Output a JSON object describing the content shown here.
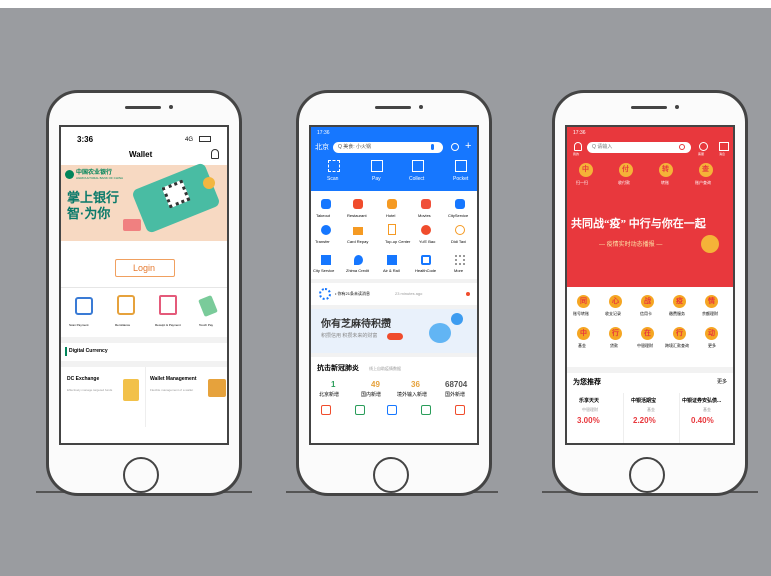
{
  "phone1": {
    "time": "3:36",
    "signal": "4G",
    "title": "Wallet",
    "bank_name": "中国农业银行",
    "bank_sub": "AGRICULTURAL BANK OF CHINA",
    "banner_line1": "掌上银行",
    "banner_line2": "智·为你",
    "login": "Login",
    "actions": [
      "Scan Payment",
      "Remittance",
      "Receipt & Payment",
      "Touch Pay"
    ],
    "section": "Digital Currency",
    "cards": [
      {
        "title": "DC Exchange",
        "desc": "Effectively manage targeted funds"
      },
      {
        "title": "Wallet Management",
        "desc": "Flexible management of a wallet"
      }
    ]
  },
  "phone2": {
    "time": "17:36",
    "city": "北京",
    "search": "Q 美食: 小火锅",
    "top_actions": [
      "Scan",
      "Pay",
      "Collect",
      "Pocket"
    ],
    "grid": [
      "Takeout",
      "Restaurant",
      "Hotel",
      "Movies",
      "CityService",
      "Transfer",
      "Card Repay",
      "Top-up Center",
      "Yu'E Bao",
      "Didi Taxi",
      "City Service",
      "Zhima Credit",
      "Air & Rail",
      "HealthCode",
      "More"
    ],
    "notice": "• 你有21条未读消息",
    "notice_time": "23 minutes ago",
    "promo_title": "你有芝麻待积攒",
    "promo_sub": "积攒信用 积攒未来的财富",
    "news_title": "抗击新冠肺炎",
    "news_sub": "线上自助疫情数据",
    "stats": [
      {
        "num": "1",
        "label": "北京新增"
      },
      {
        "num": "49",
        "label": "国内新增"
      },
      {
        "num": "36",
        "label": "境外输入新增"
      },
      {
        "num": "68704",
        "label": "国外新增"
      }
    ]
  },
  "phone3": {
    "time": "17:36",
    "search": "Q 请输入",
    "top_labels": [
      "我的",
      "客服",
      "消息"
    ],
    "quick": [
      "扫一扫",
      "收付款",
      "转账",
      "账户查询"
    ],
    "quick_icons": [
      "中",
      "付",
      "转",
      "查"
    ],
    "slogan": "共同战“疫” 中行与你在一起",
    "slogan_sub": "— 疫情实时动态播报 —",
    "grid_icons": [
      "同",
      "心",
      "战",
      "疫",
      "情",
      "中",
      "行",
      "在",
      "行",
      "动"
    ],
    "grid": [
      "账号转账",
      "收支记录",
      "信用卡",
      "缴费服务",
      "余额理财",
      "基金",
      "贷款",
      "中银理财",
      "跨境汇款查询",
      "更多"
    ],
    "rec_title": "为您推荐",
    "rec_more": "更多",
    "products": [
      {
        "name": "乐享天天",
        "type": "中银理财",
        "rate": "3.00%"
      },
      {
        "name": "中银活期宝",
        "type": "基金",
        "rate": "2.20%"
      },
      {
        "name": "中银证券安弘债...",
        "type": "基金",
        "rate": "0.40%"
      }
    ]
  },
  "colors": {
    "bg": "#9a9ca0",
    "alipay_blue": "#1677ff",
    "boc_red": "#e8383d",
    "abc_green": "#00855a"
  }
}
